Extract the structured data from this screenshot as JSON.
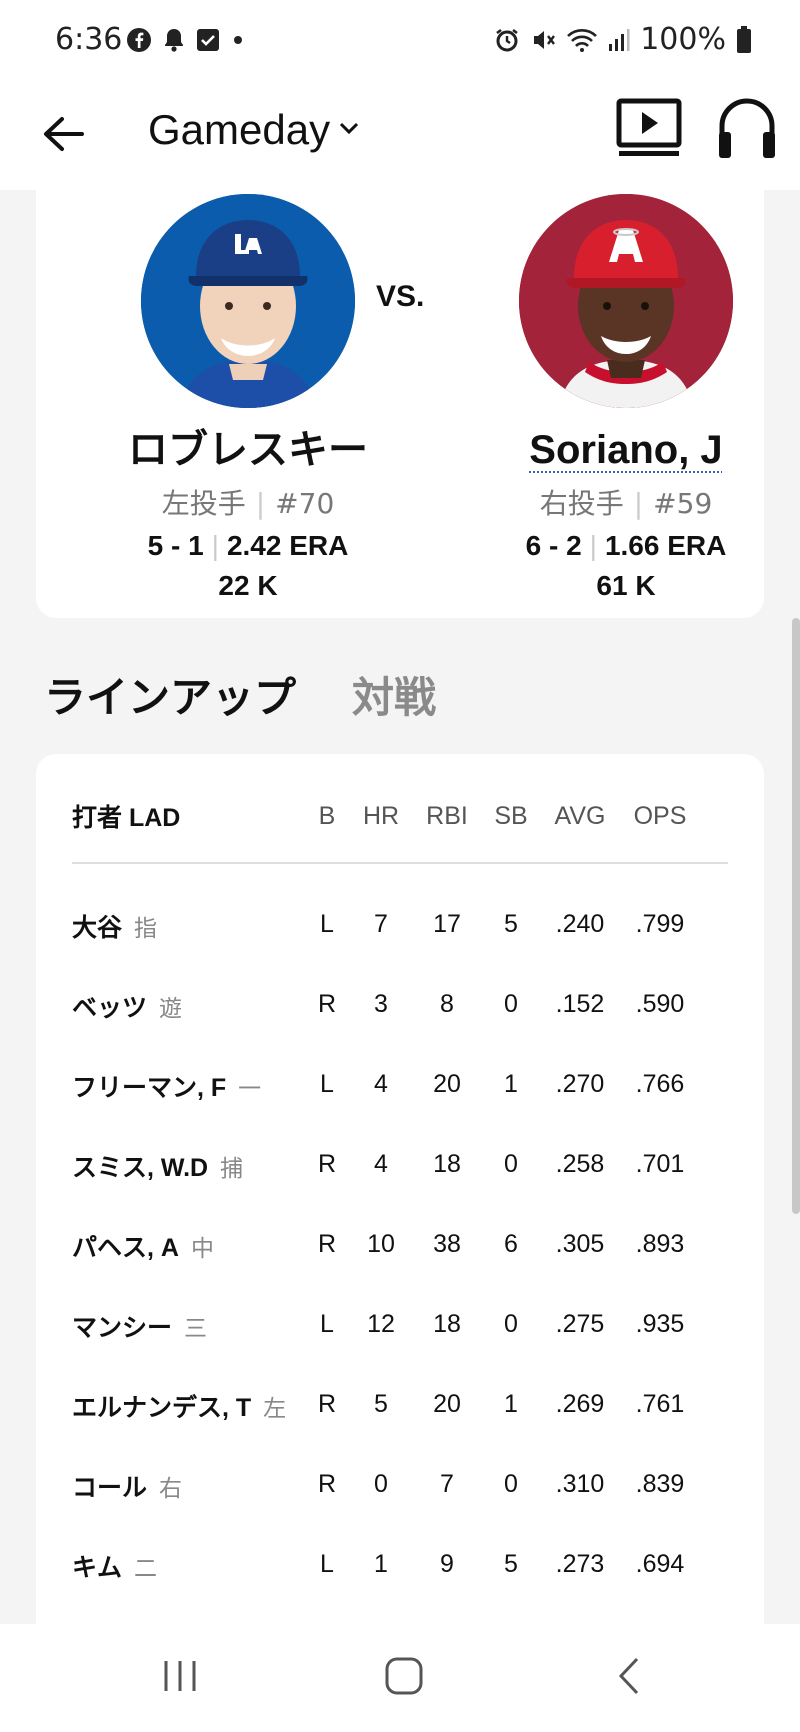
{
  "status_bar": {
    "time": "6:36",
    "battery": "100%"
  },
  "app_bar": {
    "title": "Gameday"
  },
  "matchup": {
    "vs": "VS.",
    "away_pitcher": {
      "name": "ロブレスキー",
      "hand": "左投手",
      "number": "#70",
      "record": "5 - 1",
      "era": "2.42 ERA",
      "strikeouts": "22 K",
      "team_color": "#0b5cad"
    },
    "home_pitcher": {
      "name": "Soriano, J",
      "hand": "右投手",
      "number": "#59",
      "record": "6 - 2",
      "era": "1.66 ERA",
      "strikeouts": "61 K",
      "team_color": "#a2233a"
    }
  },
  "tabs": [
    {
      "label": "ラインアップ",
      "active": true
    },
    {
      "label": "対戦",
      "active": false
    }
  ],
  "lineup": {
    "header": {
      "batter": "打者 LAD",
      "b": "B",
      "hr": "HR",
      "rbi": "RBI",
      "sb": "SB",
      "avg": "AVG",
      "ops": "OPS"
    },
    "rows": [
      {
        "name": "大谷",
        "pos": "指",
        "b": "L",
        "hr": "7",
        "rbi": "17",
        "sb": "5",
        "avg": ".240",
        "ops": ".799"
      },
      {
        "name": "ベッツ",
        "pos": "遊",
        "b": "R",
        "hr": "3",
        "rbi": "8",
        "sb": "0",
        "avg": ".152",
        "ops": ".590"
      },
      {
        "name": "フリーマン, F",
        "pos": "一",
        "b": "L",
        "hr": "4",
        "rbi": "20",
        "sb": "1",
        "avg": ".270",
        "ops": ".766"
      },
      {
        "name": "スミス, W.D",
        "pos": "捕",
        "b": "R",
        "hr": "4",
        "rbi": "18",
        "sb": "0",
        "avg": ".258",
        "ops": ".701"
      },
      {
        "name": "パヘス, A",
        "pos": "中",
        "b": "R",
        "hr": "10",
        "rbi": "38",
        "sb": "6",
        "avg": ".305",
        "ops": ".893"
      },
      {
        "name": "マンシー",
        "pos": "三",
        "b": "L",
        "hr": "12",
        "rbi": "18",
        "sb": "0",
        "avg": ".275",
        "ops": ".935"
      },
      {
        "name": "エルナンデス, T",
        "pos": "左",
        "b": "R",
        "hr": "5",
        "rbi": "20",
        "sb": "1",
        "avg": ".269",
        "ops": ".761"
      },
      {
        "name": "コール",
        "pos": "右",
        "b": "R",
        "hr": "0",
        "rbi": "7",
        "sb": "0",
        "avg": ".310",
        "ops": ".839"
      },
      {
        "name": "キム",
        "pos": "二",
        "b": "L",
        "hr": "1",
        "rbi": "9",
        "sb": "5",
        "avg": ".273",
        "ops": ".694"
      }
    ]
  },
  "colors": {
    "background": "#f4f4f4",
    "card": "#ffffff",
    "inactive_tab": "#8a8a8a"
  },
  "icons": [
    "facebook-icon",
    "bell-icon",
    "checkbox-icon",
    "dot-icon",
    "alarm-icon",
    "mute-icon",
    "wifi-icon",
    "signal-icon",
    "battery-icon",
    "back-arrow-icon",
    "chevron-down-icon",
    "tv-play-icon",
    "headphones-icon",
    "recent-apps-icon",
    "home-icon",
    "nav-back-icon"
  ]
}
